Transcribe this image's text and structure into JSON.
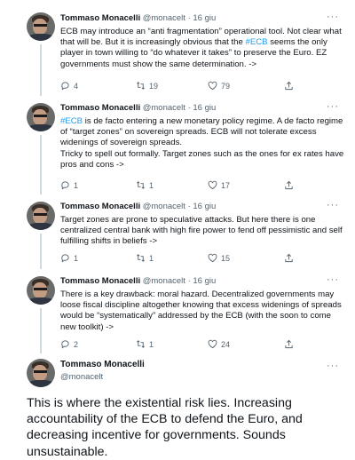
{
  "tweets": [
    {
      "name": "Tommaso Monacelli",
      "handle": "@monacelt",
      "dot": "·",
      "date": "16 giu",
      "more": "···",
      "lines": [
        "ECB may introduce an “anti fragmentation” operational tool. Not clear what",
        "that will be. But it is increasingly obvious that the ",
        "#ECB",
        " seems the only",
        "player in town willing to “do whatever it takes” to preserve the Euro. EZ",
        "governments must show the same determination. ->"
      ],
      "replies": "4",
      "retweets": "19",
      "likes": "79"
    },
    {
      "name": "Tommaso Monacelli",
      "handle": "@monacelt",
      "dot": "·",
      "date": "16 giu",
      "more": "···",
      "hashtag": "#ECB",
      "lines": [
        " is de facto entering a new monetary policy regime. A de facto regime",
        "of “target zones” on sovereign spreads.  ECB will not tolerate excess",
        "widenings of sovereign spreads.",
        "Tricky  to spell out formally. Target zones such as the ones for ex rates have",
        "pros and cons ->"
      ],
      "replies": "1",
      "retweets": "1",
      "likes": "17"
    },
    {
      "name": "Tommaso Monacelli",
      "handle": "@monacelt",
      "dot": "·",
      "date": "16 giu",
      "more": "···",
      "lines": [
        "Target zones are prone to speculative attacks. But here there is one",
        "centralized central bank with high fire power to fend off pessimistic and self",
        "fulfilling shifts in beliefs ->"
      ],
      "replies": "1",
      "retweets": "1",
      "likes": "15"
    },
    {
      "name": "Tommaso Monacelli",
      "handle": "@monacelt",
      "dot": "·",
      "date": "16 giu",
      "more": "···",
      "lines": [
        "There is a key drawback: moral hazard. Decentralized governments may",
        "loose fiscal discipline altogether knowing that excess widenings of spreads",
        "would be “systematically” addressed by the ECB (with the soon to come",
        "new toolkit) ->"
      ],
      "replies": "2",
      "retweets": "1",
      "likes": "24"
    }
  ],
  "main_tweet": {
    "name": "Tommaso Monacelli",
    "handle": "@monacelt",
    "more": "···",
    "text": "This is where the existential risk lies. Increasing accountability of the ECB to defend the Euro, and decreasing incentive for governments. Sounds unsustainable."
  },
  "colors": {
    "link": "#1d9bf0",
    "secondary": "#536471",
    "thread_line": "#cfd9de"
  }
}
